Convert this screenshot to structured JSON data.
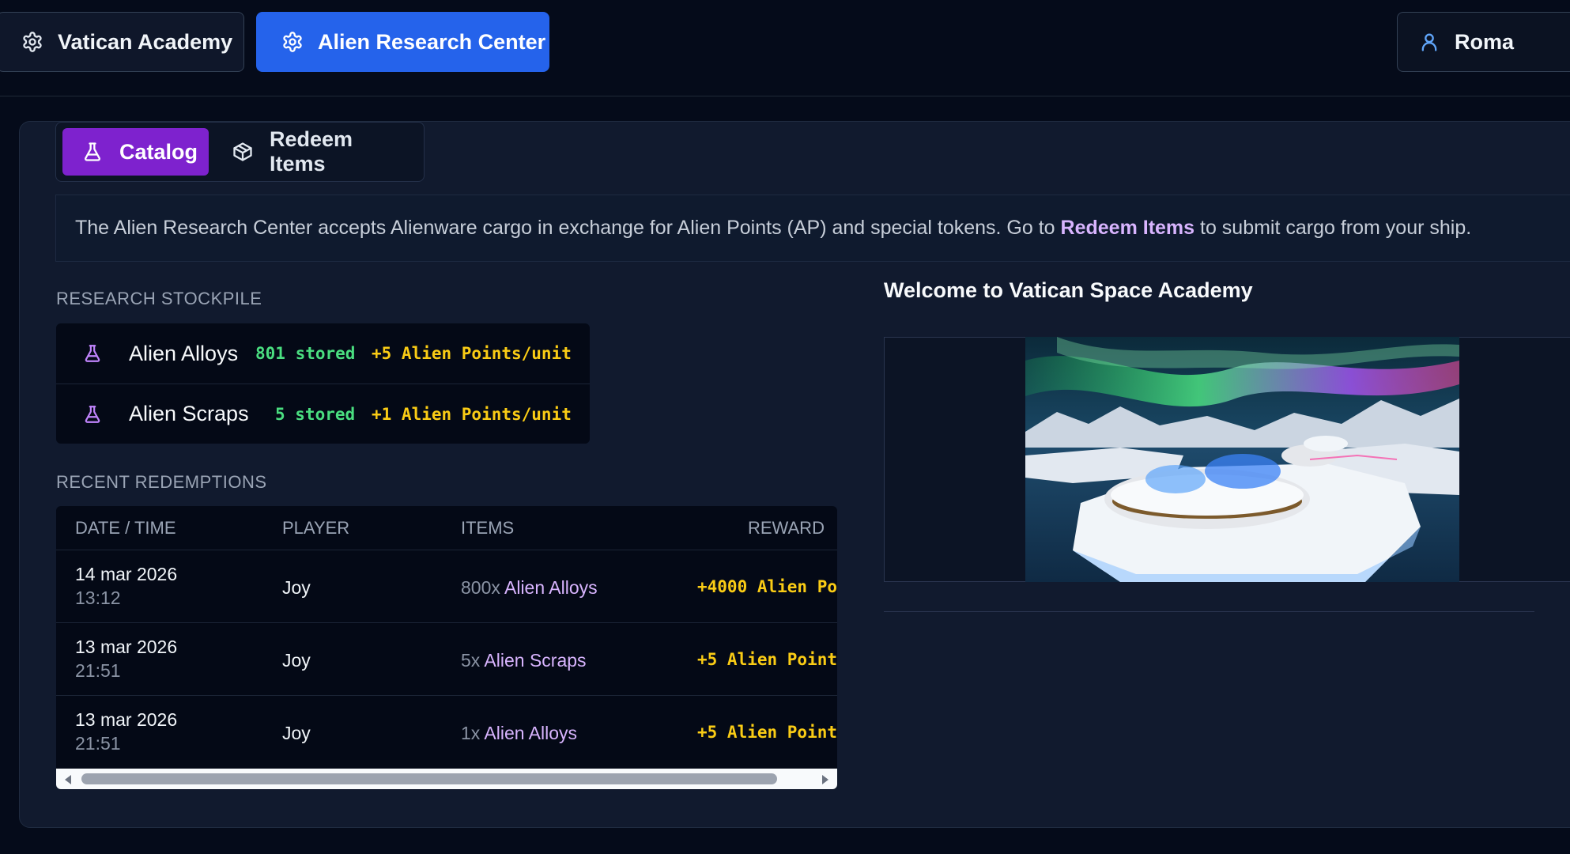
{
  "topbar": {
    "vatican_label": "Vatican Academy",
    "alien_label": "Alien Research Center",
    "user_name": "Roma"
  },
  "tabs": {
    "catalog_label": "Catalog",
    "redeem_label": "Redeem Items"
  },
  "info": {
    "text_before": "The Alien Research Center accepts Alienware cargo in exchange for Alien Points (AP) and special tokens. Go to ",
    "link_text": "Redeem Items",
    "text_after": " to submit cargo from your ship."
  },
  "stockpile": {
    "heading": "RESEARCH STOCKPILE",
    "items": [
      {
        "name": "Alien Alloys",
        "stored": "801 stored",
        "rate": "+5 Alien Points/unit"
      },
      {
        "name": "Alien Scraps",
        "stored": "5 stored",
        "rate": "+1 Alien Points/unit"
      }
    ]
  },
  "redemptions": {
    "heading": "RECENT REDEMPTIONS",
    "columns": [
      "DATE / TIME",
      "PLAYER",
      "ITEMS",
      "REWARD"
    ],
    "rows": [
      {
        "date": "14 mar 2026",
        "time": "13:12",
        "player": "Joy",
        "qty": "800x",
        "item": "Alien Alloys",
        "reward": "+4000 Alien Po"
      },
      {
        "date": "13 mar 2026",
        "time": "21:51",
        "player": "Joy",
        "qty": "5x",
        "item": "Alien Scraps",
        "reward": "+5 Alien Point"
      },
      {
        "date": "13 mar 2026",
        "time": "21:51",
        "player": "Joy",
        "qty": "1x",
        "item": "Alien Alloys",
        "reward": "+5 Alien Point"
      }
    ]
  },
  "welcome": {
    "title": "Welcome to Vatican Space Academy"
  },
  "colors": {
    "background": "#050b1a",
    "panel": "#111a2e",
    "primary_blue": "#2563eb",
    "catalog_purple": "#7e22ce",
    "link_purple": "#d8b4fe",
    "stored_green": "#4ade80",
    "reward_yellow": "#facc15"
  },
  "icons": {
    "settings": "gear-icon",
    "user": "user-icon",
    "catalog": "flask-icon",
    "redeem": "package-icon",
    "stock_item": "flask-icon"
  }
}
